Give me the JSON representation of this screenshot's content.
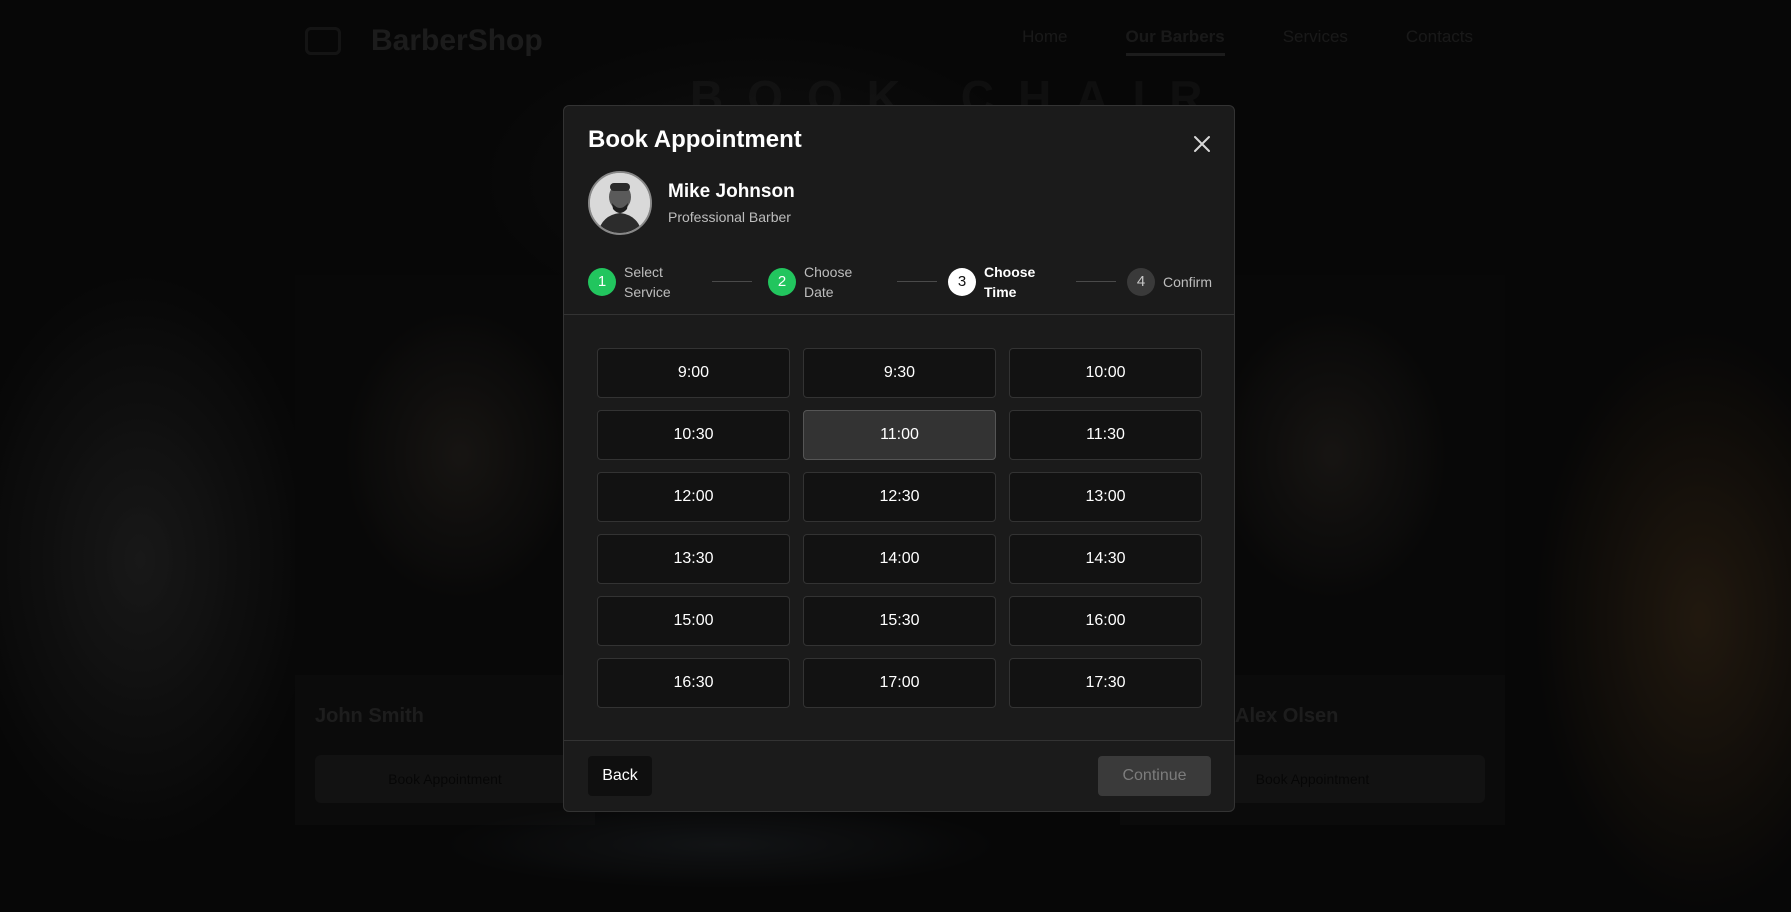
{
  "background": {
    "logo": "BarberShop",
    "nav": [
      "Home",
      "Our Barbers",
      "Services",
      "Contacts"
    ],
    "active_nav_index": 1,
    "hero_title": "BOOK CHAIR",
    "cards": [
      {
        "name": "John Smith",
        "button": "Book Appointment"
      },
      {
        "name": "Alex Olsen",
        "button": "Book Appointment"
      }
    ]
  },
  "modal": {
    "title": "Book Appointment",
    "close_icon": "close-icon",
    "barber": {
      "name": "Mike Johnson",
      "role": "Professional Barber"
    },
    "steps": [
      {
        "number": "1",
        "line1": "Select",
        "line2": "Service",
        "state": "done"
      },
      {
        "number": "2",
        "line1": "Choose",
        "line2": "Date",
        "state": "done"
      },
      {
        "number": "3",
        "line1": "Choose",
        "line2": "Time",
        "state": "current"
      },
      {
        "number": "4",
        "line1": "Confirm",
        "line2": "",
        "state": "todo"
      }
    ],
    "time_slots": [
      "9:00",
      "9:30",
      "10:00",
      "10:30",
      "11:00",
      "11:30",
      "12:00",
      "12:30",
      "13:00",
      "13:30",
      "14:00",
      "14:30",
      "15:00",
      "15:30",
      "16:00",
      "16:30",
      "17:00",
      "17:30"
    ],
    "selected_slot": "11:00",
    "back_label": "Back",
    "continue_label": "Continue",
    "continue_disabled": true
  },
  "colors": {
    "step_done": "#22c55e",
    "step_current": "#ffffff",
    "modal_bg": "#1b1b1b"
  }
}
